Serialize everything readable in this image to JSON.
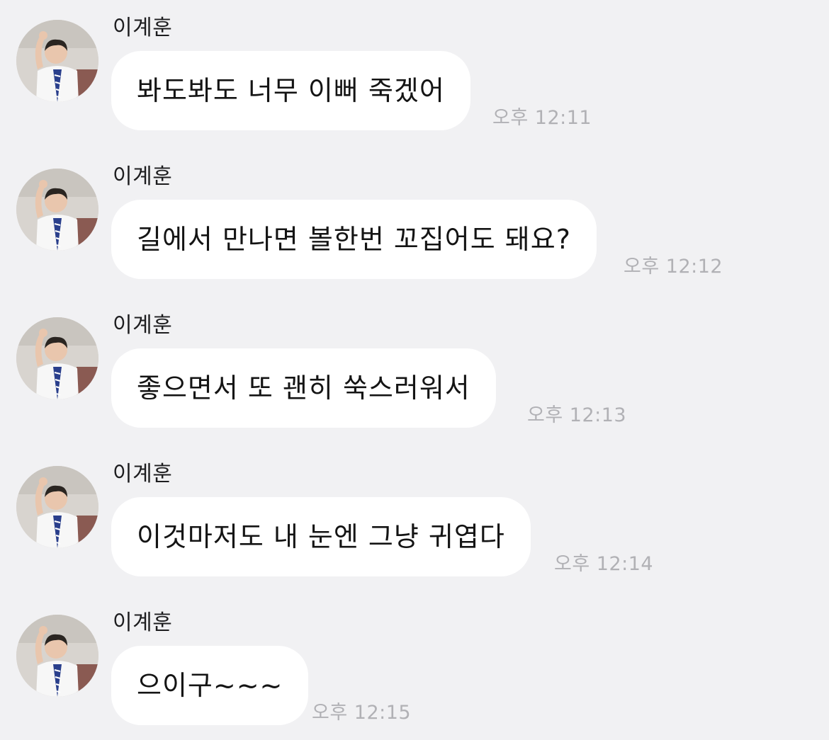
{
  "messages": [
    {
      "sender": "이계훈",
      "text": "봐도봐도 너무 이뻐 죽겠어",
      "time": "오후 12:11"
    },
    {
      "sender": "이계훈",
      "text": "길에서 만나면 볼한번 꼬집어도 돼요?",
      "time": "오후 12:12"
    },
    {
      "sender": "이계훈",
      "text": "좋으면서 또 괜히 쑥스러워서",
      "time": "오후 12:13"
    },
    {
      "sender": "이계훈",
      "text": "이것마저도 내 눈엔 그냥 귀엽다",
      "time": "오후 12:14"
    },
    {
      "sender": "이계훈",
      "text": "으이구~~~",
      "time": "오후 12:15"
    }
  ],
  "colors": {
    "background": "#f1f1f3",
    "bubble": "#ffffff",
    "timestamp": "#b1b1b5"
  }
}
